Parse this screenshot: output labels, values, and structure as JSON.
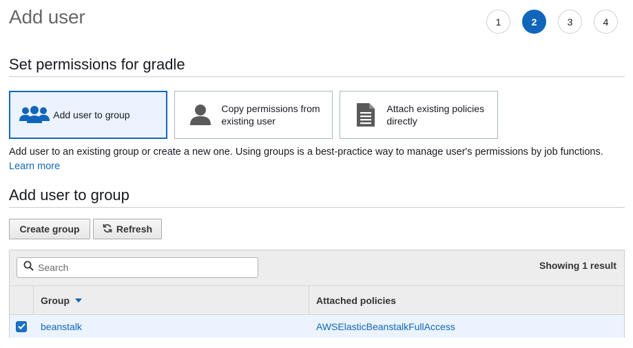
{
  "header": {
    "title": "Add user"
  },
  "steps": [
    {
      "label": "1",
      "active": false
    },
    {
      "label": "2",
      "active": true
    },
    {
      "label": "3",
      "active": false
    },
    {
      "label": "4",
      "active": false
    }
  ],
  "permissions": {
    "heading": "Set permissions for gradle",
    "options": [
      {
        "label": "Add user to group",
        "icon": "users-group-icon",
        "selected": true
      },
      {
        "label": "Copy permissions from existing user",
        "icon": "user-icon",
        "selected": false
      },
      {
        "label": "Attach existing policies directly",
        "icon": "document-icon",
        "selected": false
      }
    ],
    "description": "Add user to an existing group or create a new one. Using groups is a best-practice way to manage user's permissions by job functions.",
    "learn_more": "Learn more"
  },
  "group_section": {
    "heading": "Add user to group",
    "create_button": "Create group",
    "refresh_button": "Refresh",
    "search_placeholder": "Search",
    "result_count": "Showing 1 result",
    "columns": {
      "group": "Group",
      "policies": "Attached policies"
    },
    "rows": [
      {
        "group": "beanstalk",
        "policies": "AWSElasticBeanstalkFullAccess",
        "checked": true
      }
    ]
  },
  "colors": {
    "accent": "#1166bb",
    "selected_bg": "#eaf3fe"
  }
}
